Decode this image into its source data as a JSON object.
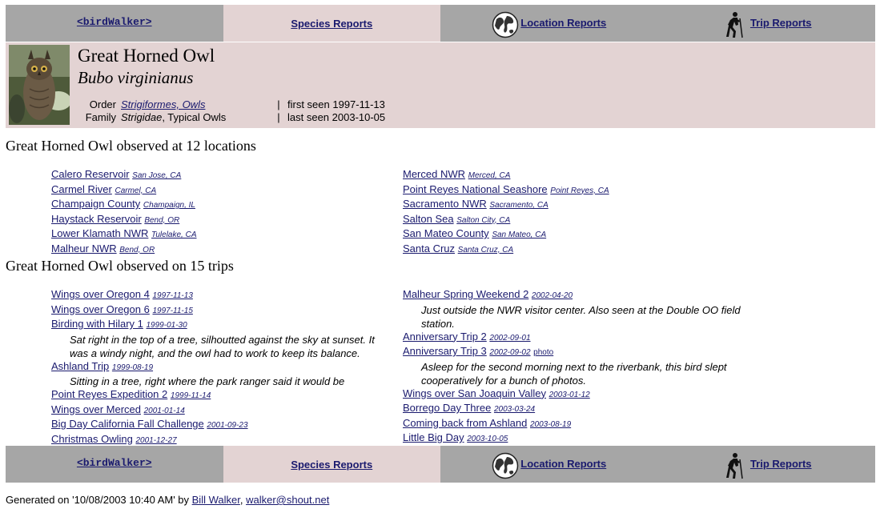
{
  "nav": {
    "home": "<birdWalker>",
    "species": "Species Reports",
    "locations": "Location Reports",
    "trips": "Trip Reports"
  },
  "bird": {
    "common_name": "Great Horned Owl",
    "latin_name": "Bubo virginianus",
    "order_label": "Order",
    "order_value": "Strigiformes, Owls",
    "family_label": "Family",
    "family_latin": "Strigidae",
    "family_common": ", Typical Owls",
    "first_seen": "first seen 1997-11-13",
    "last_seen": "last seen 2003-10-05",
    "separator": "|"
  },
  "locations_heading": "Great Horned Owl observed at 12 locations",
  "locations": {
    "left": [
      {
        "name": "Calero Reservoir",
        "place": "San Jose, CA"
      },
      {
        "name": "Carmel River",
        "place": "Carmel, CA"
      },
      {
        "name": "Champaign County",
        "place": "Champaign, IL"
      },
      {
        "name": "Haystack Reservoir",
        "place": "Bend, OR"
      },
      {
        "name": "Lower Klamath NWR",
        "place": "Tulelake, CA"
      },
      {
        "name": "Malheur NWR",
        "place": "Bend, OR"
      }
    ],
    "right": [
      {
        "name": "Merced NWR",
        "place": "Merced, CA"
      },
      {
        "name": "Point Reyes National Seashore",
        "place": "Point Reyes, CA"
      },
      {
        "name": "Sacramento NWR",
        "place": "Sacramento, CA"
      },
      {
        "name": "Salton Sea",
        "place": "Salton City, CA"
      },
      {
        "name": "San Mateo County",
        "place": "San Mateo, CA"
      },
      {
        "name": "Santa Cruz",
        "place": "Santa Cruz, CA"
      }
    ]
  },
  "trips_heading": "Great Horned Owl observed on 15 trips",
  "trips": {
    "left": [
      {
        "name": "Wings over Oregon 4",
        "date": "1997-11-13"
      },
      {
        "name": "Wings over Oregon 6",
        "date": "1997-11-15"
      },
      {
        "name": "Birding with Hilary 1",
        "date": "1999-01-30",
        "note": "Sat right in the top of a tree, silhoutted against the sky at sunset. It was a windy night, and the owl had to work to keep its balance."
      },
      {
        "name": "Ashland Trip",
        "date": "1999-08-19",
        "note": "Sitting in a tree, right where the park ranger said it would be"
      },
      {
        "name": "Point Reyes Expedition 2",
        "date": "1999-11-14"
      },
      {
        "name": "Wings over Merced",
        "date": "2001-01-14"
      },
      {
        "name": "Big Day California Fall Challenge",
        "date": "2001-09-23"
      },
      {
        "name": "Christmas Owling",
        "date": "2001-12-27"
      }
    ],
    "right": [
      {
        "name": "Malheur Spring Weekend 2",
        "date": "2002-04-20",
        "note": "Just outside the NWR visitor center. Also seen at the Double OO field station."
      },
      {
        "name": "Anniversary Trip 2",
        "date": "2002-09-01"
      },
      {
        "name": "Anniversary Trip 3",
        "date": "2002-09-02",
        "photo": "photo",
        "note": "Asleep for the second morning next to the riverbank, this bird slept cooperatively for a bunch of photos."
      },
      {
        "name": "Wings over San Joaquin Valley",
        "date": "2003-01-12"
      },
      {
        "name": "Borrego Day Three",
        "date": "2003-03-24"
      },
      {
        "name": "Coming back from Ashland",
        "date": "2003-08-19"
      },
      {
        "name": "Little Big Day",
        "date": "2003-10-05"
      }
    ]
  },
  "footer": {
    "generated": "Generated on '10/08/2003 10:40 AM' by ",
    "author": "Bill Walker",
    "comma": ", ",
    "email": "walker@shout.net"
  },
  "icons": {
    "globe": "globe-icon",
    "hiker": "hiker-icon",
    "owl_photo": "owl-thumbnail"
  },
  "colors": {
    "nav_grey": "#a6a6a6",
    "nav_pink": "#e3d3d3",
    "link": "#1a1a6e"
  }
}
